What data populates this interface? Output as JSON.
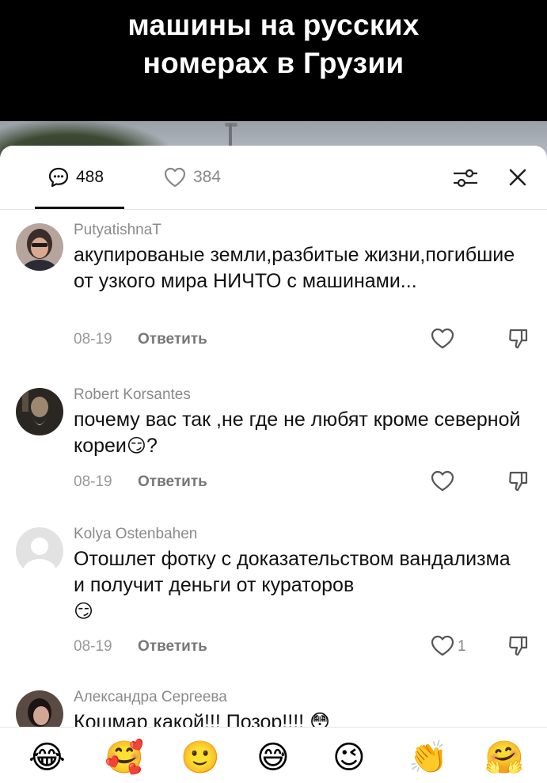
{
  "video": {
    "caption_line1": "машины на русских",
    "caption_line2": "номерах в Грузии"
  },
  "tabs": {
    "comments_count": "488",
    "likes_count": "384"
  },
  "comments": [
    {
      "author": "PutyatishnaT",
      "text": "акупированые земли,разбитые жизни,погибшие от узкого мира НИЧТО с машинами...",
      "date": "08-19",
      "reply_label": "Ответить",
      "likes": ""
    },
    {
      "author": "Robert Korsantes",
      "text": "почему вас так ,не где не любят кроме северной кореи",
      "text_emoji": "😏",
      "text_suffix": "?",
      "date": "08-19",
      "reply_label": "Ответить",
      "likes": ""
    },
    {
      "author": "Kolya Ostenbahen",
      "text": "Отошлет фотку с доказательством вандализма и получит деньги от кураторов",
      "text_emoji": "😏",
      "date": "08-19",
      "reply_label": "Ответить",
      "likes": "1"
    },
    {
      "author": "Александра Сергеева",
      "text": "Кошмар какой!!! Позор!!!! 😳"
    }
  ],
  "emoji_bar": [
    "😂",
    "🥰",
    "🙂",
    "😅",
    "😉",
    "👏",
    "🤗"
  ],
  "colors": {
    "sheet_bg": "#ffffff",
    "text_primary": "#111111",
    "text_secondary": "#8a8a8a"
  }
}
